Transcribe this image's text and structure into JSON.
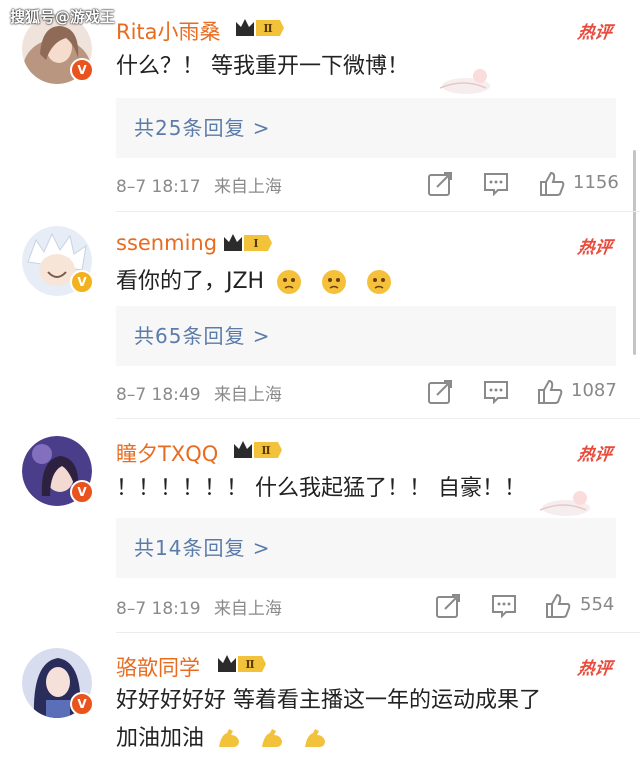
{
  "watermark": "搜狐号@游戏王",
  "hot_label": "热评",
  "comments": [
    {
      "username": "Rita小雨桑",
      "level": "Ⅱ",
      "text": "什么？！ 等我重开一下微博！",
      "replies": "共25条回复 >",
      "date": "8–7 18:17",
      "location": "来自上海",
      "likes": "1156",
      "avatar_color": "#e9d7cc"
    },
    {
      "username": "ssenming",
      "level": "Ⅰ",
      "text": "看你的了，JZH",
      "replies": "共65条回复 >",
      "date": "8–7 18:49",
      "location": "来自上海",
      "likes": "1087",
      "avatar_color": "#dfe6f2"
    },
    {
      "username": "瞳夕TXQQ",
      "level": "Ⅱ",
      "text": "！！！！！！ 什么我起猛了！！ 自豪！！",
      "replies": "共14条回复 >",
      "date": "8–7 18:19",
      "location": "来自上海",
      "likes": "554",
      "avatar_color": "#6b5ba8"
    },
    {
      "username": "骆歆同学",
      "level": "Ⅱ",
      "text": "好好好好好 等着看主播这一年的运动成果了",
      "text2": "加油加油",
      "avatar_color": "#3b3f6a"
    }
  ],
  "colors": {
    "username": "#e86b1f",
    "reply_link": "#5b7ba8",
    "hot": "#e84a3c",
    "verified_badge": "#e8531e"
  },
  "icons": [
    "share-icon",
    "comment-icon",
    "like-icon",
    "crown-level-badge",
    "verified-badge",
    "sticker-cat"
  ]
}
